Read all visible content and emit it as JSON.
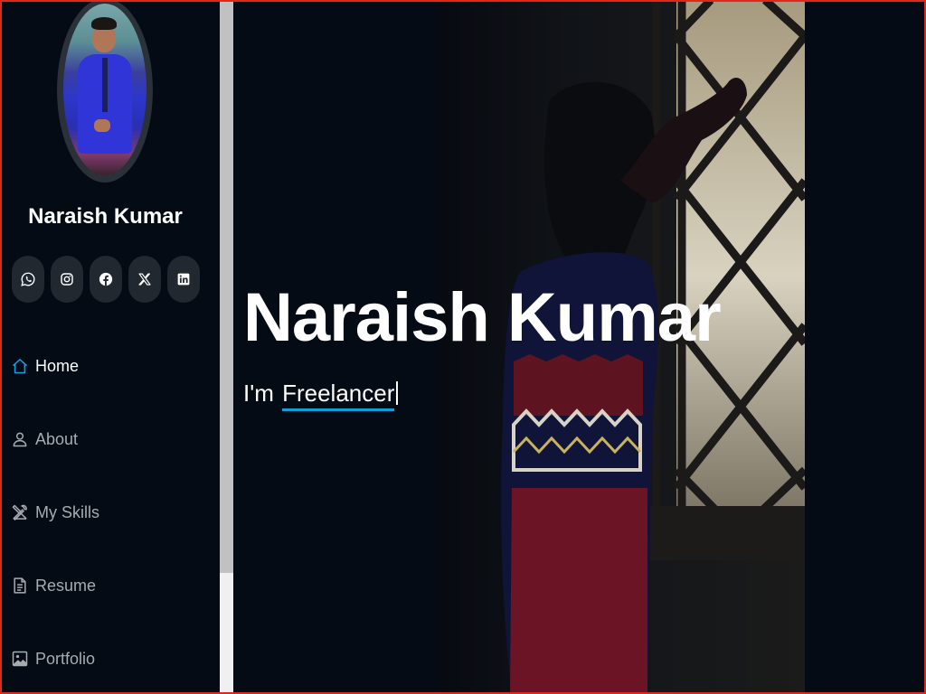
{
  "profile": {
    "name": "Naraish Kumar"
  },
  "social": [
    {
      "icon": "whatsapp-icon"
    },
    {
      "icon": "instagram-icon"
    },
    {
      "icon": "facebook-icon"
    },
    {
      "icon": "x-twitter-icon"
    },
    {
      "icon": "linkedin-icon"
    }
  ],
  "nav": {
    "items": [
      {
        "label": "Home",
        "icon": "home-icon",
        "active": true
      },
      {
        "label": "About",
        "icon": "person-icon"
      },
      {
        "label": "My Skills",
        "icon": "tools-icon"
      },
      {
        "label": "Resume",
        "icon": "file-text-icon"
      },
      {
        "label": "Portfolio",
        "icon": "images-icon"
      }
    ]
  },
  "hero": {
    "title": "Naraish Kumar",
    "prefix": "I'm",
    "typed": "Freelancer"
  },
  "colors": {
    "background": "#040b14",
    "accent": "#149ddd",
    "frame": "#e1261c"
  }
}
